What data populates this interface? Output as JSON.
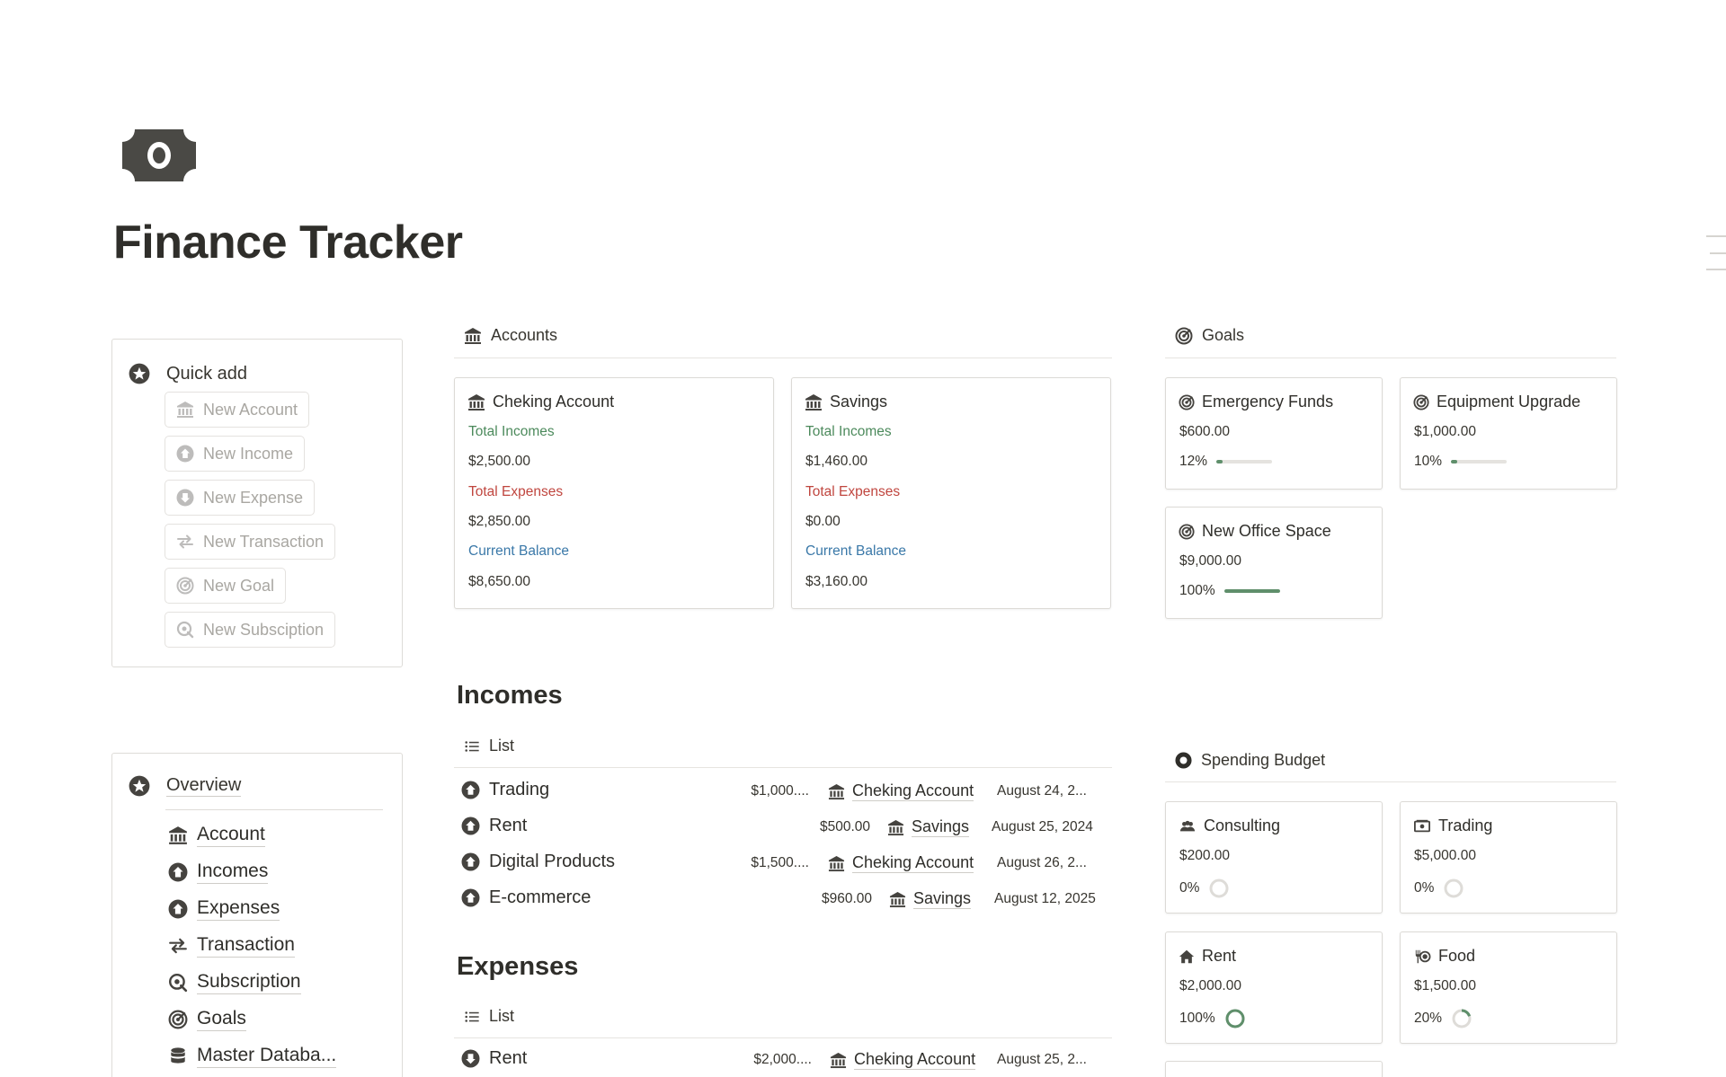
{
  "page": {
    "title": "Finance Tracker",
    "icon": "money-bill-icon"
  },
  "quick_add": {
    "title": "Quick add",
    "buttons": [
      {
        "label": "New Account",
        "icon": "bank-icon"
      },
      {
        "label": "New Income",
        "icon": "arrow-up-circle-icon"
      },
      {
        "label": "New Expense",
        "icon": "arrow-down-circle-icon"
      },
      {
        "label": "New Transaction",
        "icon": "transfer-icon"
      },
      {
        "label": "New Goal",
        "icon": "target-icon"
      },
      {
        "label": "New Subsciption",
        "icon": "subscription-icon"
      }
    ]
  },
  "overview": {
    "title": "Overview",
    "items": [
      {
        "label": "Account",
        "icon": "bank-icon"
      },
      {
        "label": "Incomes",
        "icon": "arrow-up-circle-icon"
      },
      {
        "label": "Expenses",
        "icon": "arrow-up-circle-icon"
      },
      {
        "label": "Transaction",
        "icon": "transfer-icon"
      },
      {
        "label": "Subscription",
        "icon": "subscription-icon"
      },
      {
        "label": "Goals",
        "icon": "target-icon"
      },
      {
        "label": "Master Databa...",
        "icon": "database-icon"
      }
    ]
  },
  "accounts": {
    "title": "Accounts",
    "cards": [
      {
        "name": "Cheking Account",
        "income_label": "Total Incomes",
        "income": "$2,500.00",
        "expense_label": "Total Expenses",
        "expense": "$2,850.00",
        "balance_label": "Current Balance",
        "balance": "$8,650.00"
      },
      {
        "name": "Savings",
        "income_label": "Total Incomes",
        "income": "$1,460.00",
        "expense_label": "Total Expenses",
        "expense": "$0.00",
        "balance_label": "Current Balance",
        "balance": "$3,160.00"
      }
    ]
  },
  "goals": {
    "title": "Goals",
    "cards": [
      {
        "name": "Emergency Funds",
        "amount": "$600.00",
        "percent": "12%",
        "fraction": 0.12
      },
      {
        "name": "Equipment Upgrade",
        "amount": "$1,000.00",
        "percent": "10%",
        "fraction": 0.1
      },
      {
        "name": "New Office Space",
        "amount": "$9,000.00",
        "percent": "100%",
        "fraction": 1.0
      }
    ]
  },
  "incomes": {
    "title": "Incomes",
    "view": "List",
    "rows": [
      {
        "name": "Trading",
        "amount": "$1,000....",
        "account": "Cheking Account",
        "date": "August 24, 2..."
      },
      {
        "name": "Rent",
        "amount": "$500.00",
        "account": "Savings",
        "date": "August 25, 2024"
      },
      {
        "name": "Digital Products",
        "amount": "$1,500....",
        "account": "Cheking Account",
        "date": "August 26, 2..."
      },
      {
        "name": "E-commerce",
        "amount": "$960.00",
        "account": "Savings",
        "date": "August 12, 2025"
      }
    ]
  },
  "expenses": {
    "title": "Expenses",
    "view": "List",
    "rows": [
      {
        "name": "Rent",
        "amount": "$2,000....",
        "account": "Cheking Account",
        "date": "August 25, 2..."
      }
    ]
  },
  "budget": {
    "title": "Spending Budget",
    "cards": [
      {
        "name": "Consulting",
        "icon": "people-icon",
        "amount": "$200.00",
        "percent": "0%",
        "fraction": 0.0
      },
      {
        "name": "Trading",
        "icon": "cash-icon",
        "amount": "$5,000.00",
        "percent": "0%",
        "fraction": 0.0
      },
      {
        "name": "Rent",
        "icon": "house-icon",
        "amount": "$2,000.00",
        "percent": "100%",
        "fraction": 1.0
      },
      {
        "name": "Food",
        "icon": "utensils-icon",
        "amount": "$1,500.00",
        "percent": "20%",
        "fraction": 0.2
      }
    ]
  },
  "colors": {
    "accent_green": "#5f8f6b",
    "income_label": "#4c8a5c",
    "expense_label": "#c0463f",
    "balance_label": "#3a78a8"
  }
}
